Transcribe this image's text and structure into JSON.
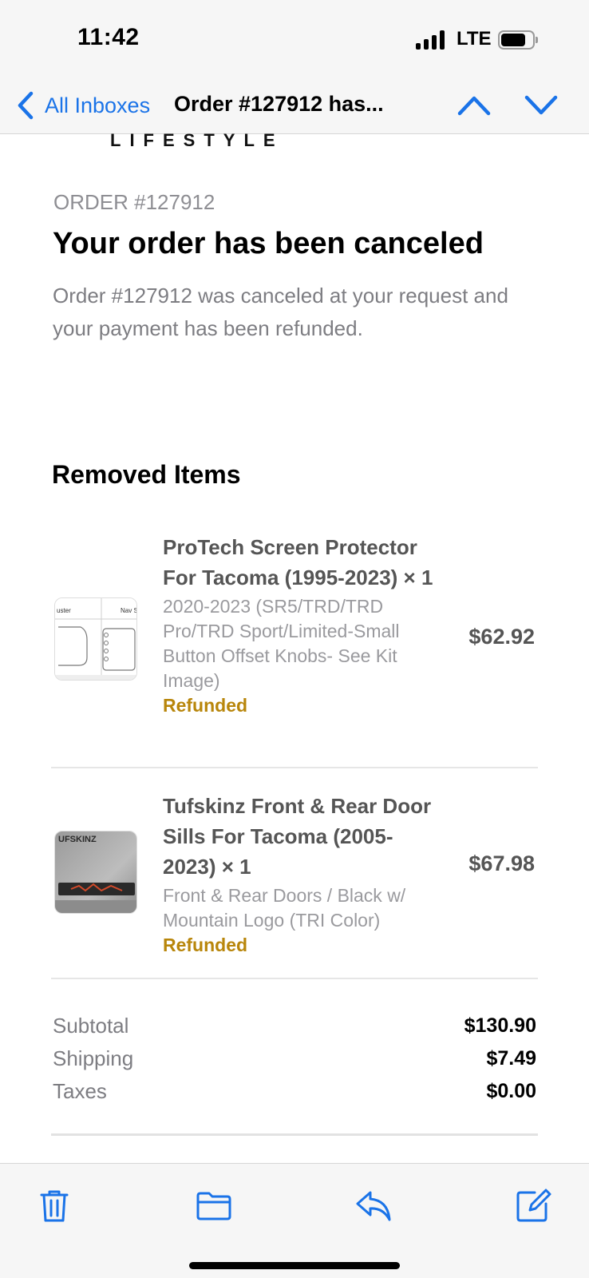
{
  "status_bar": {
    "time": "11:42",
    "carrier": "LTE"
  },
  "nav": {
    "back_label": "All Inboxes",
    "title": "Order #127912 has...",
    "accent_color": "#1a73e8"
  },
  "email": {
    "brand_wordmark": "LIFESTYLE",
    "order_label": "ORDER #127912",
    "headline": "Your order has been canceled",
    "message": "Order #127912 was canceled at your request and your payment has been refunded.",
    "section_title": "Removed Items",
    "items": [
      {
        "name": "ProTech Screen Protector For Tacoma (1995-2023) × 1",
        "variant": "2020-2023 (SR5/TRD/TRD Pro/TRD Sport/Limited-Small Button Offset Knobs- See Kit Image)",
        "status": "Refunded",
        "price": "$62.92",
        "thumb_left_label": "uster",
        "thumb_right_label": "Nav S"
      },
      {
        "name": "Tufskinz Front & Rear Door Sills For Tacoma (2005-2023) × 1",
        "variant": "Front & Rear Doors / Black w/ Mountain Logo (TRI Color)",
        "status": "Refunded",
        "price": "$67.98",
        "thumb_label": "UFSKINZ"
      }
    ],
    "totals": [
      {
        "label": "Subtotal",
        "value": "$130.90"
      },
      {
        "label": "Shipping",
        "value": "$7.49"
      },
      {
        "label": "Taxes",
        "value": "$0.00"
      }
    ],
    "refund_status_color": "#b8860b"
  },
  "toolbar": {
    "icons": [
      "trash-icon",
      "folder-icon",
      "reply-icon",
      "compose-icon"
    ]
  }
}
